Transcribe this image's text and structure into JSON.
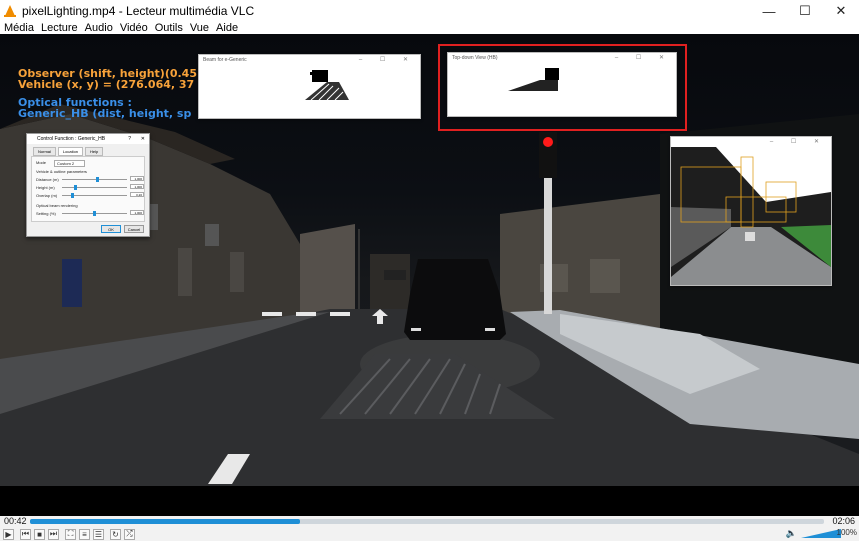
{
  "window": {
    "title": "pixelLighting.mp4 - Lecteur multimédia VLC",
    "minimize": "—",
    "maximize": "☐",
    "close": "✕"
  },
  "menu": [
    "Média",
    "Lecture",
    "Audio",
    "Vidéo",
    "Outils",
    "Vue",
    "Aide"
  ],
  "overlay": {
    "observer": "Observer (shift, height)(0.45",
    "vehicle": "Vehicle (x, y) = (276.064, 37",
    "optical_title": "Optical functions :",
    "optical_value": "Generic_HB (dist, height, sp"
  },
  "subwindows": {
    "left_title": "Beam for e-Generic",
    "middle_title": "Top-down View (HB)",
    "window_ctrls": "– ☐ ✕"
  },
  "dialog": {
    "title": "Control Function : Generic_HB",
    "help": "?",
    "close": "✕",
    "tabs": [
      "Normal",
      "Location",
      "Help"
    ],
    "mode_label": "Mode",
    "mode_value": "Custom 2",
    "section1": "Vehicle & outline parameters",
    "rows": [
      {
        "label": "Distance (m)",
        "value": "1,000",
        "level": 0.55
      },
      {
        "label": "Height (m)",
        "value": "1,000",
        "level": 0.2
      },
      {
        "label": "Overlap (m)",
        "value": "0,20",
        "level": 0.15
      }
    ],
    "section2": "Optical beam rendering",
    "row4": {
      "label": "Setting (%)",
      "value": "1,000",
      "level": 0.5
    },
    "ok": "OK",
    "cancel": "Cancel"
  },
  "player": {
    "time_elapsed": "00:42",
    "time_total": "02:06",
    "progress": 0.34,
    "volume_pct": "100%",
    "buttons": [
      "play",
      "prev",
      "stop",
      "next",
      "fullscreen",
      "extended",
      "playlist",
      "loop",
      "random"
    ]
  }
}
